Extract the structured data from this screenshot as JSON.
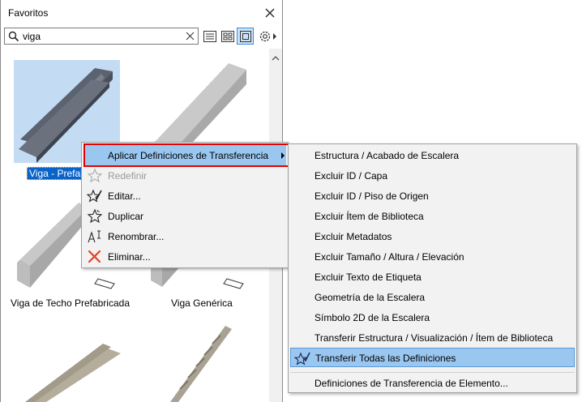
{
  "palette": {
    "title": "Favoritos",
    "search": {
      "value": "viga",
      "placeholder": ""
    },
    "items": [
      {
        "label": "Viga - Prefab"
      },
      {
        "label": ""
      },
      {
        "label": "Viga de Techo Prefabricada"
      },
      {
        "label": "Viga Genérica"
      }
    ]
  },
  "context_menu": {
    "items": [
      {
        "label": "Aplicar Definiciones de Transferencia",
        "icon": "none",
        "has_submenu": true,
        "highlighted": true
      },
      {
        "label": "Redefinir",
        "icon": "star-icon",
        "disabled": true
      },
      {
        "label": "Editar...",
        "icon": "edit-star-icon"
      },
      {
        "label": "Duplicar",
        "icon": "duplicate-star-icon"
      },
      {
        "label": "Renombrar...",
        "icon": "rename-icon"
      },
      {
        "label": "Eliminar...",
        "icon": "delete-x-icon"
      }
    ]
  },
  "submenu": {
    "items": [
      {
        "label": "Estructura / Acabado de Escalera"
      },
      {
        "label": "Excluir ID / Capa"
      },
      {
        "label": "Excluir ID / Piso de Origen"
      },
      {
        "label": "Excluir Ítem de Biblioteca"
      },
      {
        "label": "Excluir Metadatos"
      },
      {
        "label": "Excluir Tamaño / Altura / Elevación"
      },
      {
        "label": "Excluir Texto de Etiqueta"
      },
      {
        "label": "Geometría de la Escalera"
      },
      {
        "label": "Símbolo 2D de la Escalera"
      },
      {
        "label": "Transferir Estructura / Visualización / Ítem de Biblioteca"
      },
      {
        "label": "Transferir Todas las Definiciones",
        "highlighted": true
      },
      {
        "label": "Definiciones de Transferencia de Elemento..."
      }
    ]
  },
  "colors": {
    "accent": "#0a64c8",
    "highlight": "#9ac7f0",
    "annotation": "#e00000"
  }
}
